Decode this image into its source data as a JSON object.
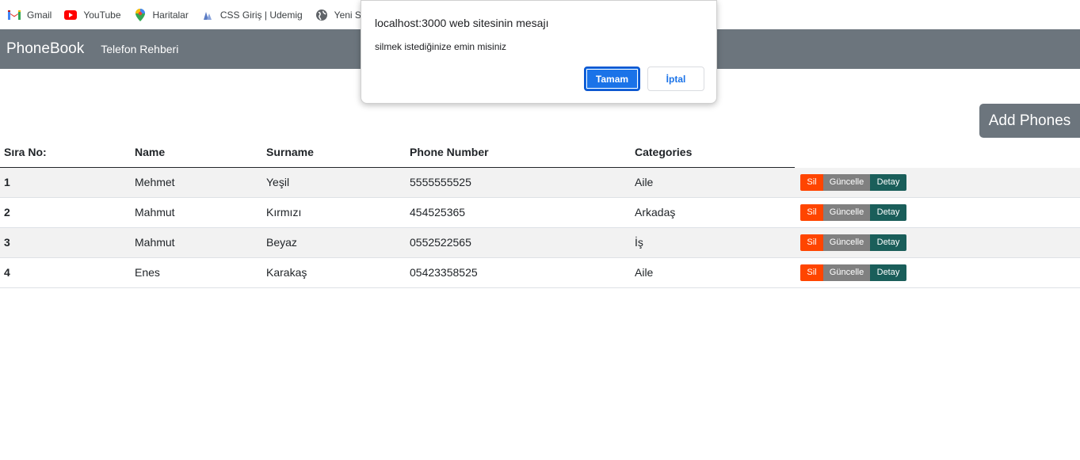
{
  "bookmarks": [
    {
      "label": "Gmail",
      "icon": "gmail-icon"
    },
    {
      "label": "YouTube",
      "icon": "youtube-icon"
    },
    {
      "label": "Haritalar",
      "icon": "maps-icon"
    },
    {
      "label": "CSS Giriş | Udemig",
      "icon": "udemig-icon"
    },
    {
      "label": "Yeni Se",
      "icon": "globe-icon"
    }
  ],
  "navbar": {
    "brand": "PhoneBook",
    "link": "Telefon Rehberi"
  },
  "add_button": "Add Phones",
  "table": {
    "headers": [
      "Sıra No:",
      "Name",
      "Surname",
      "Phone Number",
      "Categories"
    ],
    "rows": [
      {
        "no": "1",
        "name": "Mehmet",
        "surname": "Yeşil",
        "phone": "5555555525",
        "category": "Aile"
      },
      {
        "no": "2",
        "name": "Mahmut",
        "surname": "Kırmızı",
        "phone": "454525365",
        "category": "Arkadaş"
      },
      {
        "no": "3",
        "name": "Mahmut",
        "surname": "Beyaz",
        "phone": "0552522565",
        "category": "İş"
      },
      {
        "no": "4",
        "name": "Enes",
        "surname": "Karakaş",
        "phone": "05423358525",
        "category": "Aile"
      }
    ],
    "actions": {
      "delete": "Sil",
      "update": "Güncelle",
      "detail": "Detay"
    }
  },
  "dialog": {
    "title": "localhost:3000 web sitesinin mesajı",
    "message": "silmek istediğinize emin misiniz",
    "ok": "Tamam",
    "cancel": "İptal"
  },
  "colors": {
    "navbar": "#6c757d",
    "delete": "#ff4500",
    "update": "#808080",
    "detail": "#1a5e5a",
    "dialog_primary": "#1a73e8"
  }
}
